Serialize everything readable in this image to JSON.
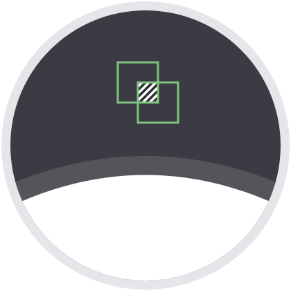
{
  "icon": {
    "name": "intersection-icon",
    "description_hidden": "",
    "colors": {
      "ring": "#e6e5ea",
      "background_dark": "#3b3c43",
      "band": "#54555b",
      "inner_white": "#ffffff",
      "accent": "#7fc47f",
      "overlap_fill": "#ffffff",
      "overlap_stripe": "#2b2c31"
    }
  }
}
